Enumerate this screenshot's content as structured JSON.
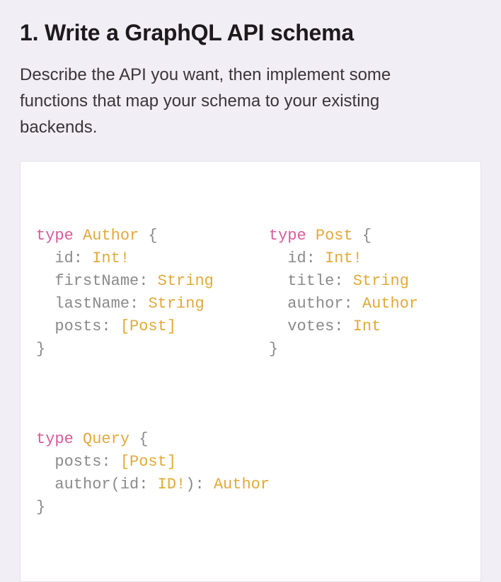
{
  "heading": "1. Write a GraphQL API schema",
  "description": "Describe the API you want, then implement some functions that map your schema to your existing backends.",
  "code": {
    "kw": "type",
    "author": {
      "name": "Author",
      "open": " {",
      "l1a": "  id: ",
      "l1b": "Int!",
      "l2a": "  firstName: ",
      "l2b": "String",
      "l3a": "  lastName: ",
      "l3b": "String",
      "l4a": "  posts: ",
      "l4b": "[Post]",
      "close": "}"
    },
    "post": {
      "name": "Post",
      "open": " {",
      "l1a": "  id: ",
      "l1b": "Int!",
      "l2a": "  title: ",
      "l2b": "String",
      "l3a": "  author: ",
      "l3b": "Author",
      "l4a": "  votes: ",
      "l4b": "Int",
      "close": "}"
    },
    "query": {
      "name": "Query",
      "open": " {",
      "l1a": "  posts: ",
      "l1b": "[Post]",
      "l2a": "  author(id: ",
      "l2b": "ID!",
      "l2c": "): ",
      "l2d": "Author",
      "close": "}"
    }
  }
}
